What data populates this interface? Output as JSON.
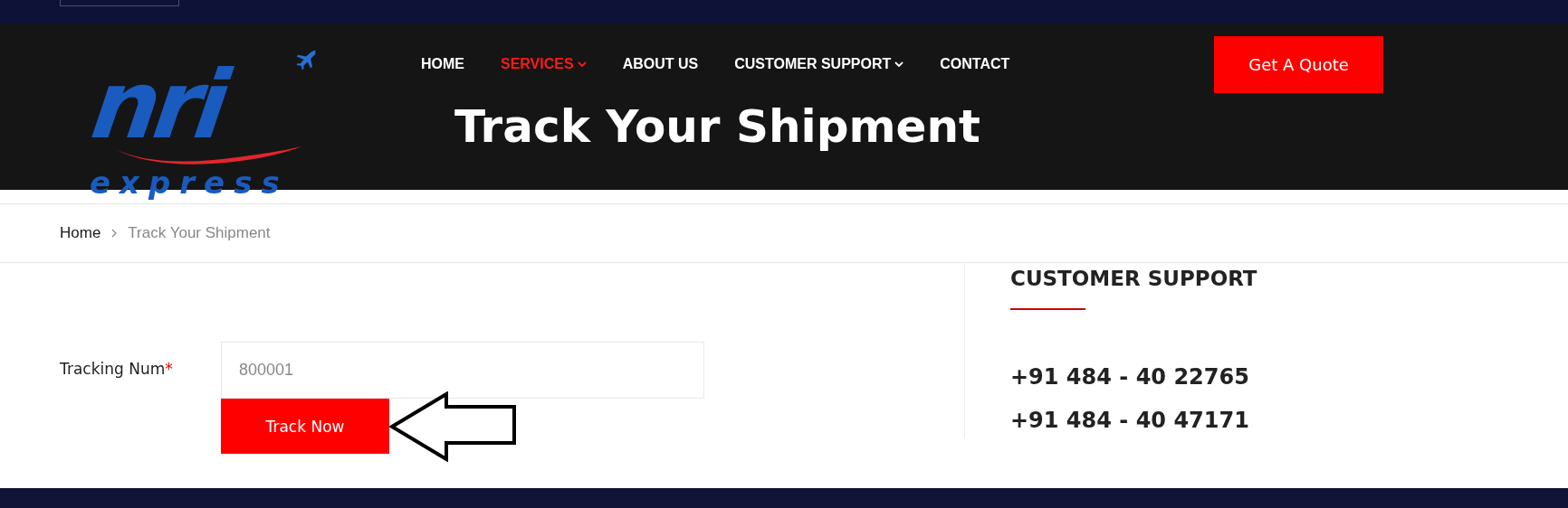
{
  "logo": {
    "wordmark": "nri",
    "tagline": "express"
  },
  "nav": [
    {
      "label": "HOME",
      "selected": false,
      "dropdown": false
    },
    {
      "label": "SERVICES",
      "selected": true,
      "dropdown": true
    },
    {
      "label": "ABOUT US",
      "selected": false,
      "dropdown": false
    },
    {
      "label": "CUSTOMER SUPPORT",
      "selected": false,
      "dropdown": true
    },
    {
      "label": "CONTACT",
      "selected": false,
      "dropdown": false
    }
  ],
  "quote_button": "Get A Quote",
  "page_title": "Track Your Shipment",
  "breadcrumb": [
    {
      "label": "Home",
      "current": false
    },
    {
      "label": "Track Your Shipment",
      "current": true
    }
  ],
  "form": {
    "label": "Tracking Num",
    "required_mark": "*",
    "value": "800001",
    "button": "Track Now"
  },
  "support": {
    "heading": "CUSTOMER SUPPORT",
    "phones": [
      "+91 484 - 40 22765",
      "+91 484 - 40 47171"
    ]
  }
}
